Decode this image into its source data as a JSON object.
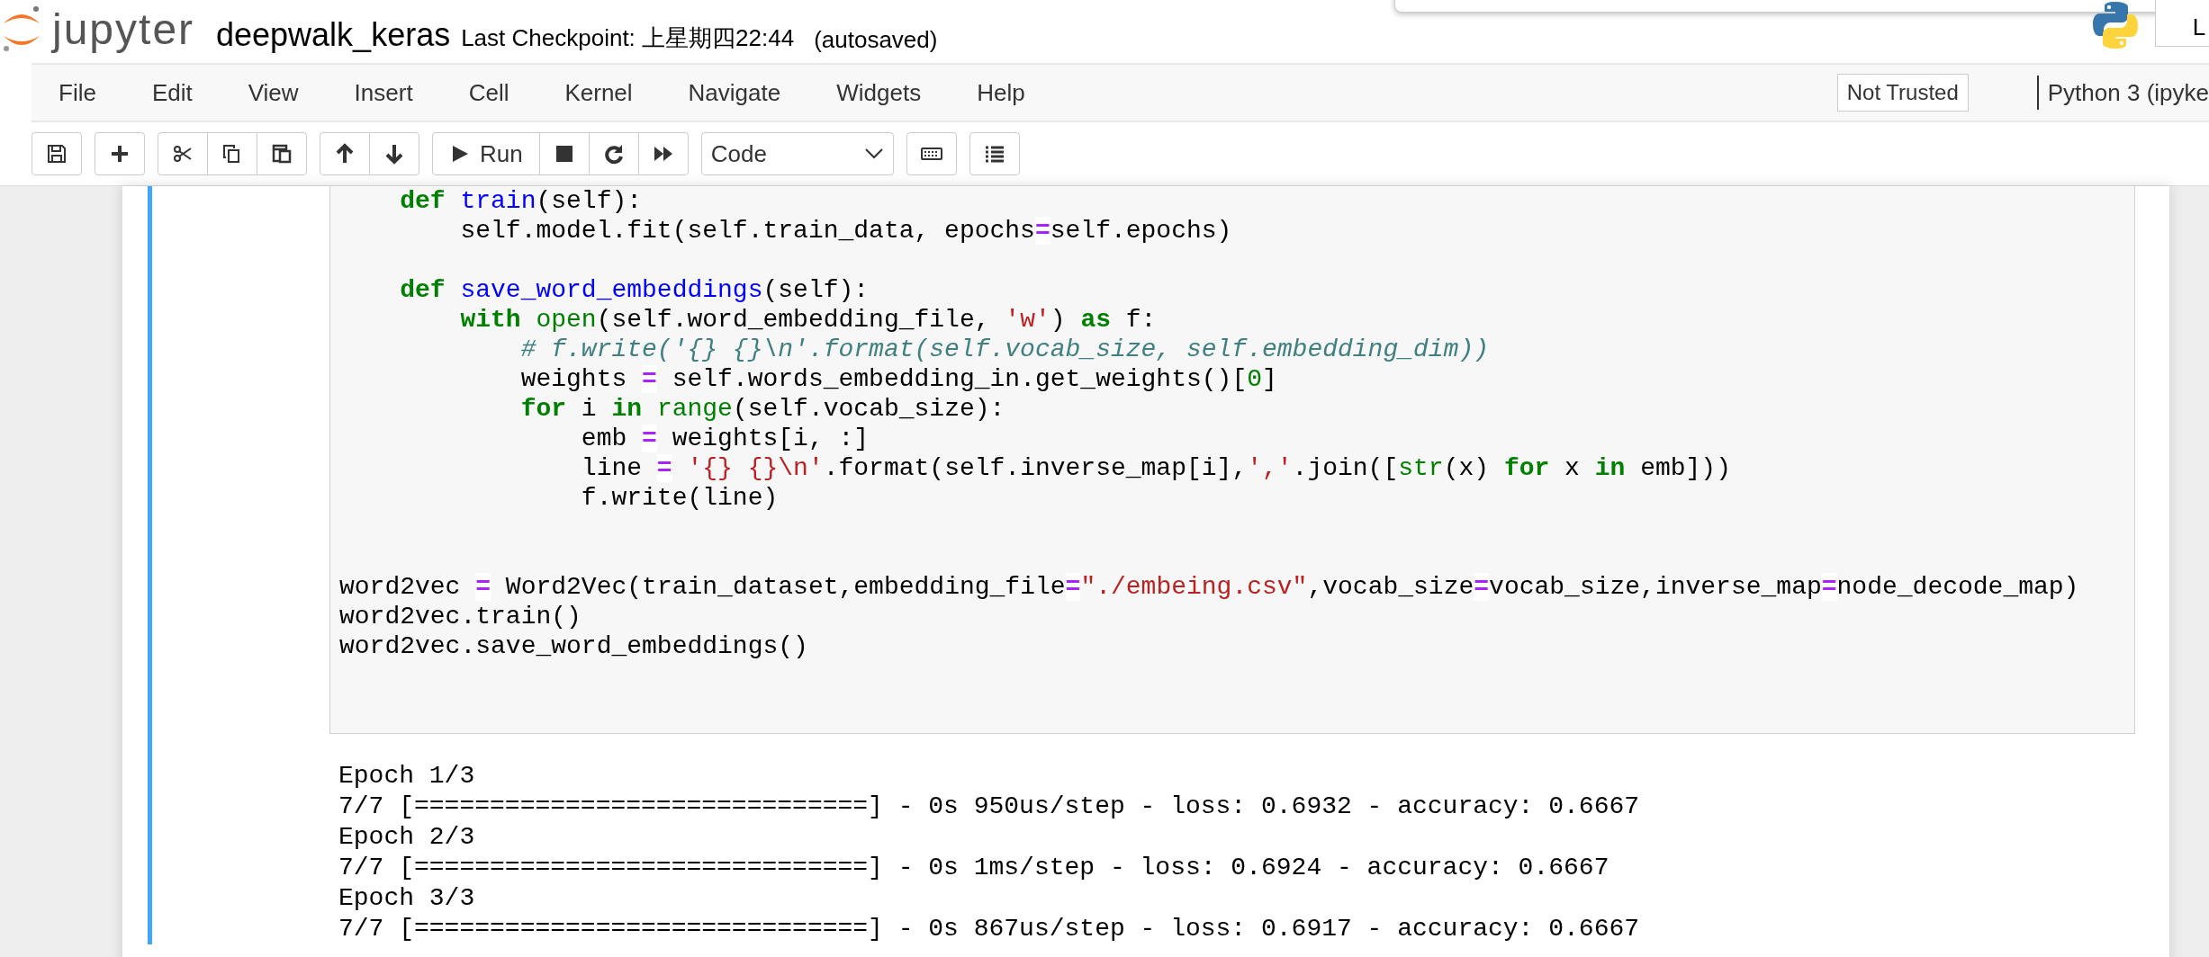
{
  "header": {
    "logo_text": "jupyter",
    "notebook_name": "deepwalk_keras",
    "checkpoint": "Last Checkpoint: 上星期四22:44",
    "autosave": "(autosaved)",
    "user_button": "L"
  },
  "menu": [
    "File",
    "Edit",
    "View",
    "Insert",
    "Cell",
    "Kernel",
    "Navigate",
    "Widgets",
    "Help"
  ],
  "trust_button": "Not Trusted",
  "kernel_name": "Python 3 (ipyke",
  "toolbar": {
    "run_label": "Run",
    "cell_type": "Code"
  },
  "code_lines": [
    {
      "kind": "code",
      "tokens": [
        {
          "t": "    def ",
          "kind": "kw"
        },
        {
          "t": "train",
          "kind": "fn"
        },
        {
          "t": "(self):",
          "kind": "plain"
        }
      ]
    },
    {
      "kind": "code",
      "tokens": [
        {
          "t": "        self.model.fit(self.train_data, epochs",
          "kind": "plain"
        },
        {
          "t": "=",
          "kind": "op"
        },
        {
          "t": "self.epochs)",
          "kind": "plain"
        }
      ]
    },
    {
      "kind": "blank"
    },
    {
      "kind": "code",
      "tokens": [
        {
          "t": "    def ",
          "kind": "kw"
        },
        {
          "t": "save_word_embeddings",
          "kind": "fn"
        },
        {
          "t": "(self):",
          "kind": "plain"
        }
      ]
    },
    {
      "kind": "code",
      "tokens": [
        {
          "t": "        with ",
          "kind": "kw"
        },
        {
          "t": "open",
          "kind": "builtin"
        },
        {
          "t": "(self.word_embedding_file, ",
          "kind": "plain"
        },
        {
          "t": "'w'",
          "kind": "str"
        },
        {
          "t": ") ",
          "kind": "plain"
        },
        {
          "t": "as",
          "kind": "kw"
        },
        {
          "t": " f:",
          "kind": "plain"
        }
      ]
    },
    {
      "kind": "code",
      "tokens": [
        {
          "t": "            # f.write('{} {}\\n'.format(self.vocab_size, self.embedding_dim))",
          "kind": "comment"
        }
      ]
    },
    {
      "kind": "code",
      "tokens": [
        {
          "t": "            weights ",
          "kind": "plain"
        },
        {
          "t": "=",
          "kind": "op"
        },
        {
          "t": " self.words_embedding_in.get_weights()[",
          "kind": "plain"
        },
        {
          "t": "0",
          "kind": "num"
        },
        {
          "t": "]",
          "kind": "plain"
        }
      ]
    },
    {
      "kind": "code",
      "tokens": [
        {
          "t": "            for",
          "kind": "kw"
        },
        {
          "t": " i ",
          "kind": "plain"
        },
        {
          "t": "in ",
          "kind": "kw"
        },
        {
          "t": "range",
          "kind": "builtin"
        },
        {
          "t": "(self.vocab_size):",
          "kind": "plain"
        }
      ]
    },
    {
      "kind": "code",
      "tokens": [
        {
          "t": "                emb ",
          "kind": "plain"
        },
        {
          "t": "=",
          "kind": "op"
        },
        {
          "t": " weights[i, :]",
          "kind": "plain"
        }
      ]
    },
    {
      "kind": "code",
      "tokens": [
        {
          "t": "                line ",
          "kind": "plain"
        },
        {
          "t": "=",
          "kind": "op"
        },
        {
          "t": " '{} {}\\n'",
          "kind": "str"
        },
        {
          "t": ".format(self.inverse_map[i],",
          "kind": "plain"
        },
        {
          "t": "','",
          "kind": "str"
        },
        {
          "t": ".join([",
          "kind": "plain"
        },
        {
          "t": "str",
          "kind": "builtin"
        },
        {
          "t": "(x) ",
          "kind": "plain"
        },
        {
          "t": "for",
          "kind": "kw"
        },
        {
          "t": " x ",
          "kind": "plain"
        },
        {
          "t": "in",
          "kind": "kw"
        },
        {
          "t": " emb]))",
          "kind": "plain"
        }
      ]
    },
    {
      "kind": "code",
      "tokens": [
        {
          "t": "                f.write(line)",
          "kind": "plain"
        }
      ]
    },
    {
      "kind": "blank"
    },
    {
      "kind": "blank"
    },
    {
      "kind": "code",
      "tokens": [
        {
          "t": "word2vec ",
          "kind": "plain"
        },
        {
          "t": "=",
          "kind": "op"
        },
        {
          "t": " Word2Vec(train_dataset,embedding_file",
          "kind": "plain"
        },
        {
          "t": "=",
          "kind": "op"
        },
        {
          "t": "\"./embeing.csv\"",
          "kind": "str"
        },
        {
          "t": ",vocab_size",
          "kind": "plain"
        },
        {
          "t": "=",
          "kind": "op"
        },
        {
          "t": "vocab_size,inverse_map",
          "kind": "plain"
        },
        {
          "t": "=",
          "kind": "op"
        },
        {
          "t": "node_decode_map)",
          "kind": "plain"
        }
      ]
    },
    {
      "kind": "code",
      "tokens": [
        {
          "t": "word2vec.train()",
          "kind": "plain"
        }
      ]
    },
    {
      "kind": "code",
      "tokens": [
        {
          "t": "word2vec.save_word_embeddings()",
          "kind": "plain"
        }
      ]
    }
  ],
  "output_lines": [
    "Epoch 1/3",
    "7/7 [==============================] - 0s 950us/step - loss: 0.6932 - accuracy: 0.6667",
    "Epoch 2/3",
    "7/7 [==============================] - 0s 1ms/step - loss: 0.6924 - accuracy: 0.6667",
    "Epoch 3/3",
    "7/7 [==============================] - 0s 867us/step - loss: 0.6917 - accuracy: 0.6667"
  ]
}
